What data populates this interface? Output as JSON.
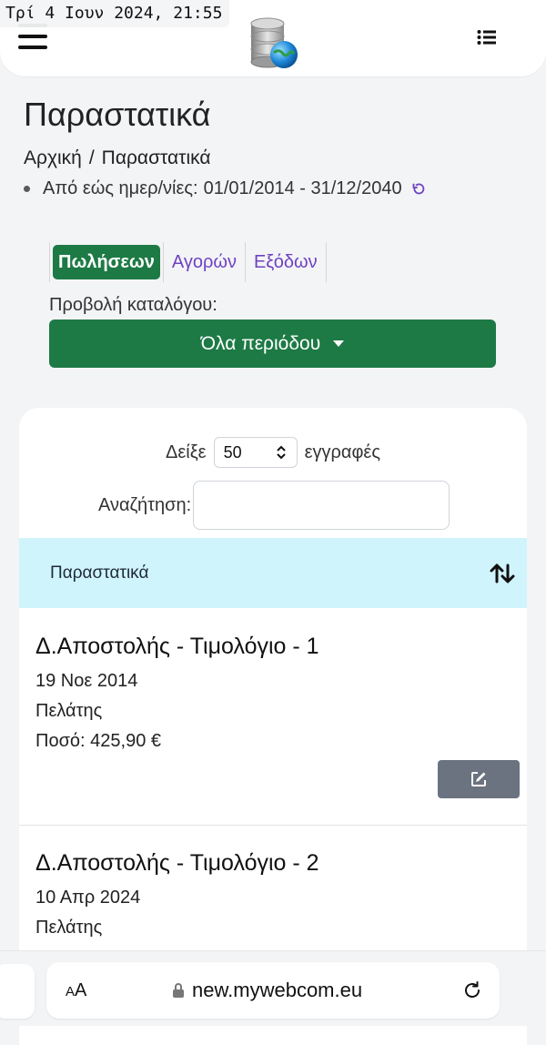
{
  "overlay": {
    "datetime": "Τρί 4 Ιουν 2024, 21:55"
  },
  "header": {
    "logo_icon": "database-globe-icon"
  },
  "page": {
    "title": "Παραστατικά",
    "breadcrumb": {
      "home": "Αρχική",
      "separator": "/",
      "current": "Παραστατικά"
    },
    "date_range": {
      "label": "Από εώς ημερ/νίες:",
      "value": "01/01/2014 - 31/12/2040"
    }
  },
  "tabs": [
    {
      "label": "Πωλήσεων",
      "active": true
    },
    {
      "label": "Αγορών",
      "active": false
    },
    {
      "label": "Εξόδων",
      "active": false
    }
  ],
  "catalog": {
    "label": "Προβολή καταλόγου:",
    "button_label": "Όλα περιόδου"
  },
  "table_controls": {
    "show_prefix": "Δείξε",
    "page_size": "50",
    "show_suffix": "εγγραφές",
    "search_label": "Αναζήτηση:",
    "search_value": ""
  },
  "table": {
    "header": "Παραστατικά",
    "rows": [
      {
        "title": "Δ.Αποστολής - Τιμολόγιο - 1",
        "date": "19 Νοε 2014",
        "party": "Πελάτης",
        "amount_label": "Ποσό: 425,90 €"
      },
      {
        "title": "Δ.Αποστολής - Τιμολόγιο - 2",
        "date": "10 Απρ 2024",
        "party": "Πελάτης"
      }
    ]
  },
  "browser": {
    "text_size": "AA",
    "url": "new.mywebcom.eu"
  },
  "colors": {
    "primary_green": "#1d7a45",
    "link_purple": "#6f42c1",
    "table_header_bg": "#cff4fc",
    "edit_button_gray": "#6b7280",
    "page_bg": "#f3f4f6"
  }
}
